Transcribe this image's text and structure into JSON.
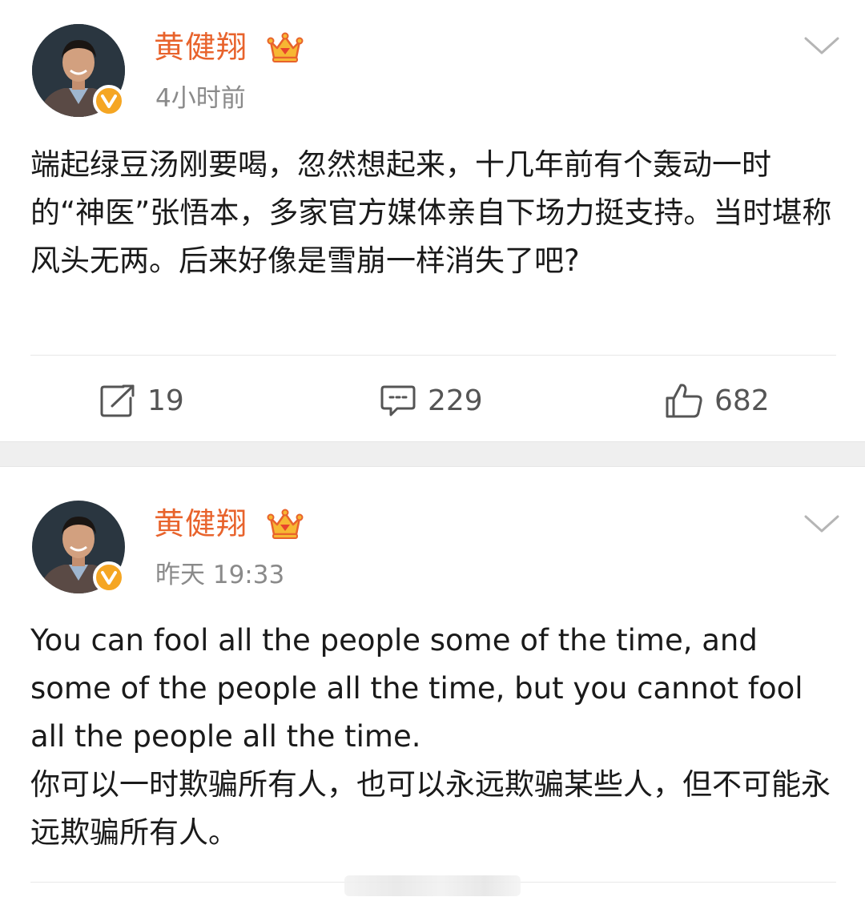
{
  "posts": [
    {
      "username": "黄健翔",
      "time": "4小时前",
      "content": [
        "端起绿豆汤刚要喝，忽然想起来，十几年前有个轰动一时的“神医”张悟本，多家官方媒体亲自下场力挺支持。当时堪称风头无两。后来好像是雪崩一样消失了吧?"
      ],
      "actions": {
        "repost_count": "19",
        "comment_count": "229",
        "like_count": "682"
      }
    },
    {
      "username": "黄健翔",
      "time": "昨天 19:33",
      "content": [
        "You can fool all the people some of the time, and some of the people all the time, but you cannot fool all the people all the time.",
        "你可以一时欺骗所有人，也可以永远欺骗某些人，但不可能永远欺骗所有人。"
      ]
    }
  ],
  "colors": {
    "username": "#e8632c",
    "verified_badge": "#f5a623",
    "meta_gray": "#8a8a8a",
    "separator": "#efefef"
  },
  "icons": {
    "avatar": "user-avatar",
    "verified": "verified-v-icon",
    "crown": "vip-crown-icon",
    "menu": "chevron-down-icon",
    "repost": "repost-icon",
    "comment": "comment-icon",
    "like": "like-icon"
  }
}
